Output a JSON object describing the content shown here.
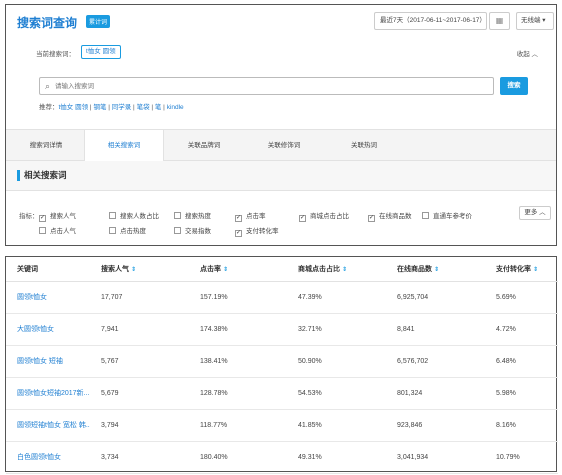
{
  "header": {
    "title": "搜索词查询",
    "badge": "累计词",
    "date_range": "最近7天（2017-06-11~2017-06-17）",
    "device": "无线端"
  },
  "current_search": {
    "label": "当前搜索词：",
    "term": "t恤女 圆领",
    "collapse": "收起"
  },
  "search": {
    "placeholder": "请输入搜索词",
    "button": "搜索"
  },
  "recommend": {
    "label": "推荐：",
    "items": [
      "t恤女 圆领",
      "钢笔",
      "同学录",
      "笔袋",
      "笔",
      "kindle"
    ]
  },
  "tabs": [
    "搜索词详情",
    "相关搜索词",
    "关联品牌词",
    "关联修饰词",
    "关联热词"
  ],
  "section_title": "相关搜索词",
  "metrics": {
    "label": "指标：",
    "row1": [
      {
        "label": "搜索人气",
        "checked": true
      },
      {
        "label": "搜索人数占比",
        "checked": false
      },
      {
        "label": "搜索热度",
        "checked": false
      },
      {
        "label": "点击率",
        "checked": true
      },
      {
        "label": "商城点击占比",
        "checked": true
      },
      {
        "label": "在线商品数",
        "checked": true
      },
      {
        "label": "直通车参考价",
        "checked": false
      }
    ],
    "row2": [
      {
        "label": "点击人气",
        "checked": false
      },
      {
        "label": "点击热度",
        "checked": false
      },
      {
        "label": "交易指数",
        "checked": false
      },
      {
        "label": "支付转化率",
        "checked": true
      }
    ],
    "more": "更多"
  },
  "table": {
    "headers": [
      "关键词",
      "搜索人气",
      "点击率",
      "商城点击占比",
      "在线商品数",
      "支付转化率"
    ],
    "rows": [
      [
        "圆领t恤女",
        "17,707",
        "157.19%",
        "47.39%",
        "6,925,704",
        "5.69%"
      ],
      [
        "大圆领t恤女",
        "7,941",
        "174.38%",
        "32.71%",
        "8,841",
        "4.72%"
      ],
      [
        "圆领t恤女 短袖",
        "5,767",
        "138.41%",
        "50.90%",
        "6,576,702",
        "6.48%"
      ],
      [
        "圆领t恤女短袖2017新...",
        "5,679",
        "128.78%",
        "54.53%",
        "801,324",
        "5.98%"
      ],
      [
        "圆领短袖t恤女 宽松 韩...",
        "3,794",
        "118.77%",
        "41.85%",
        "923,846",
        "8.16%"
      ],
      [
        "白色圆领t恤女",
        "3,734",
        "180.40%",
        "49.31%",
        "3,041,934",
        "10.79%"
      ]
    ]
  }
}
